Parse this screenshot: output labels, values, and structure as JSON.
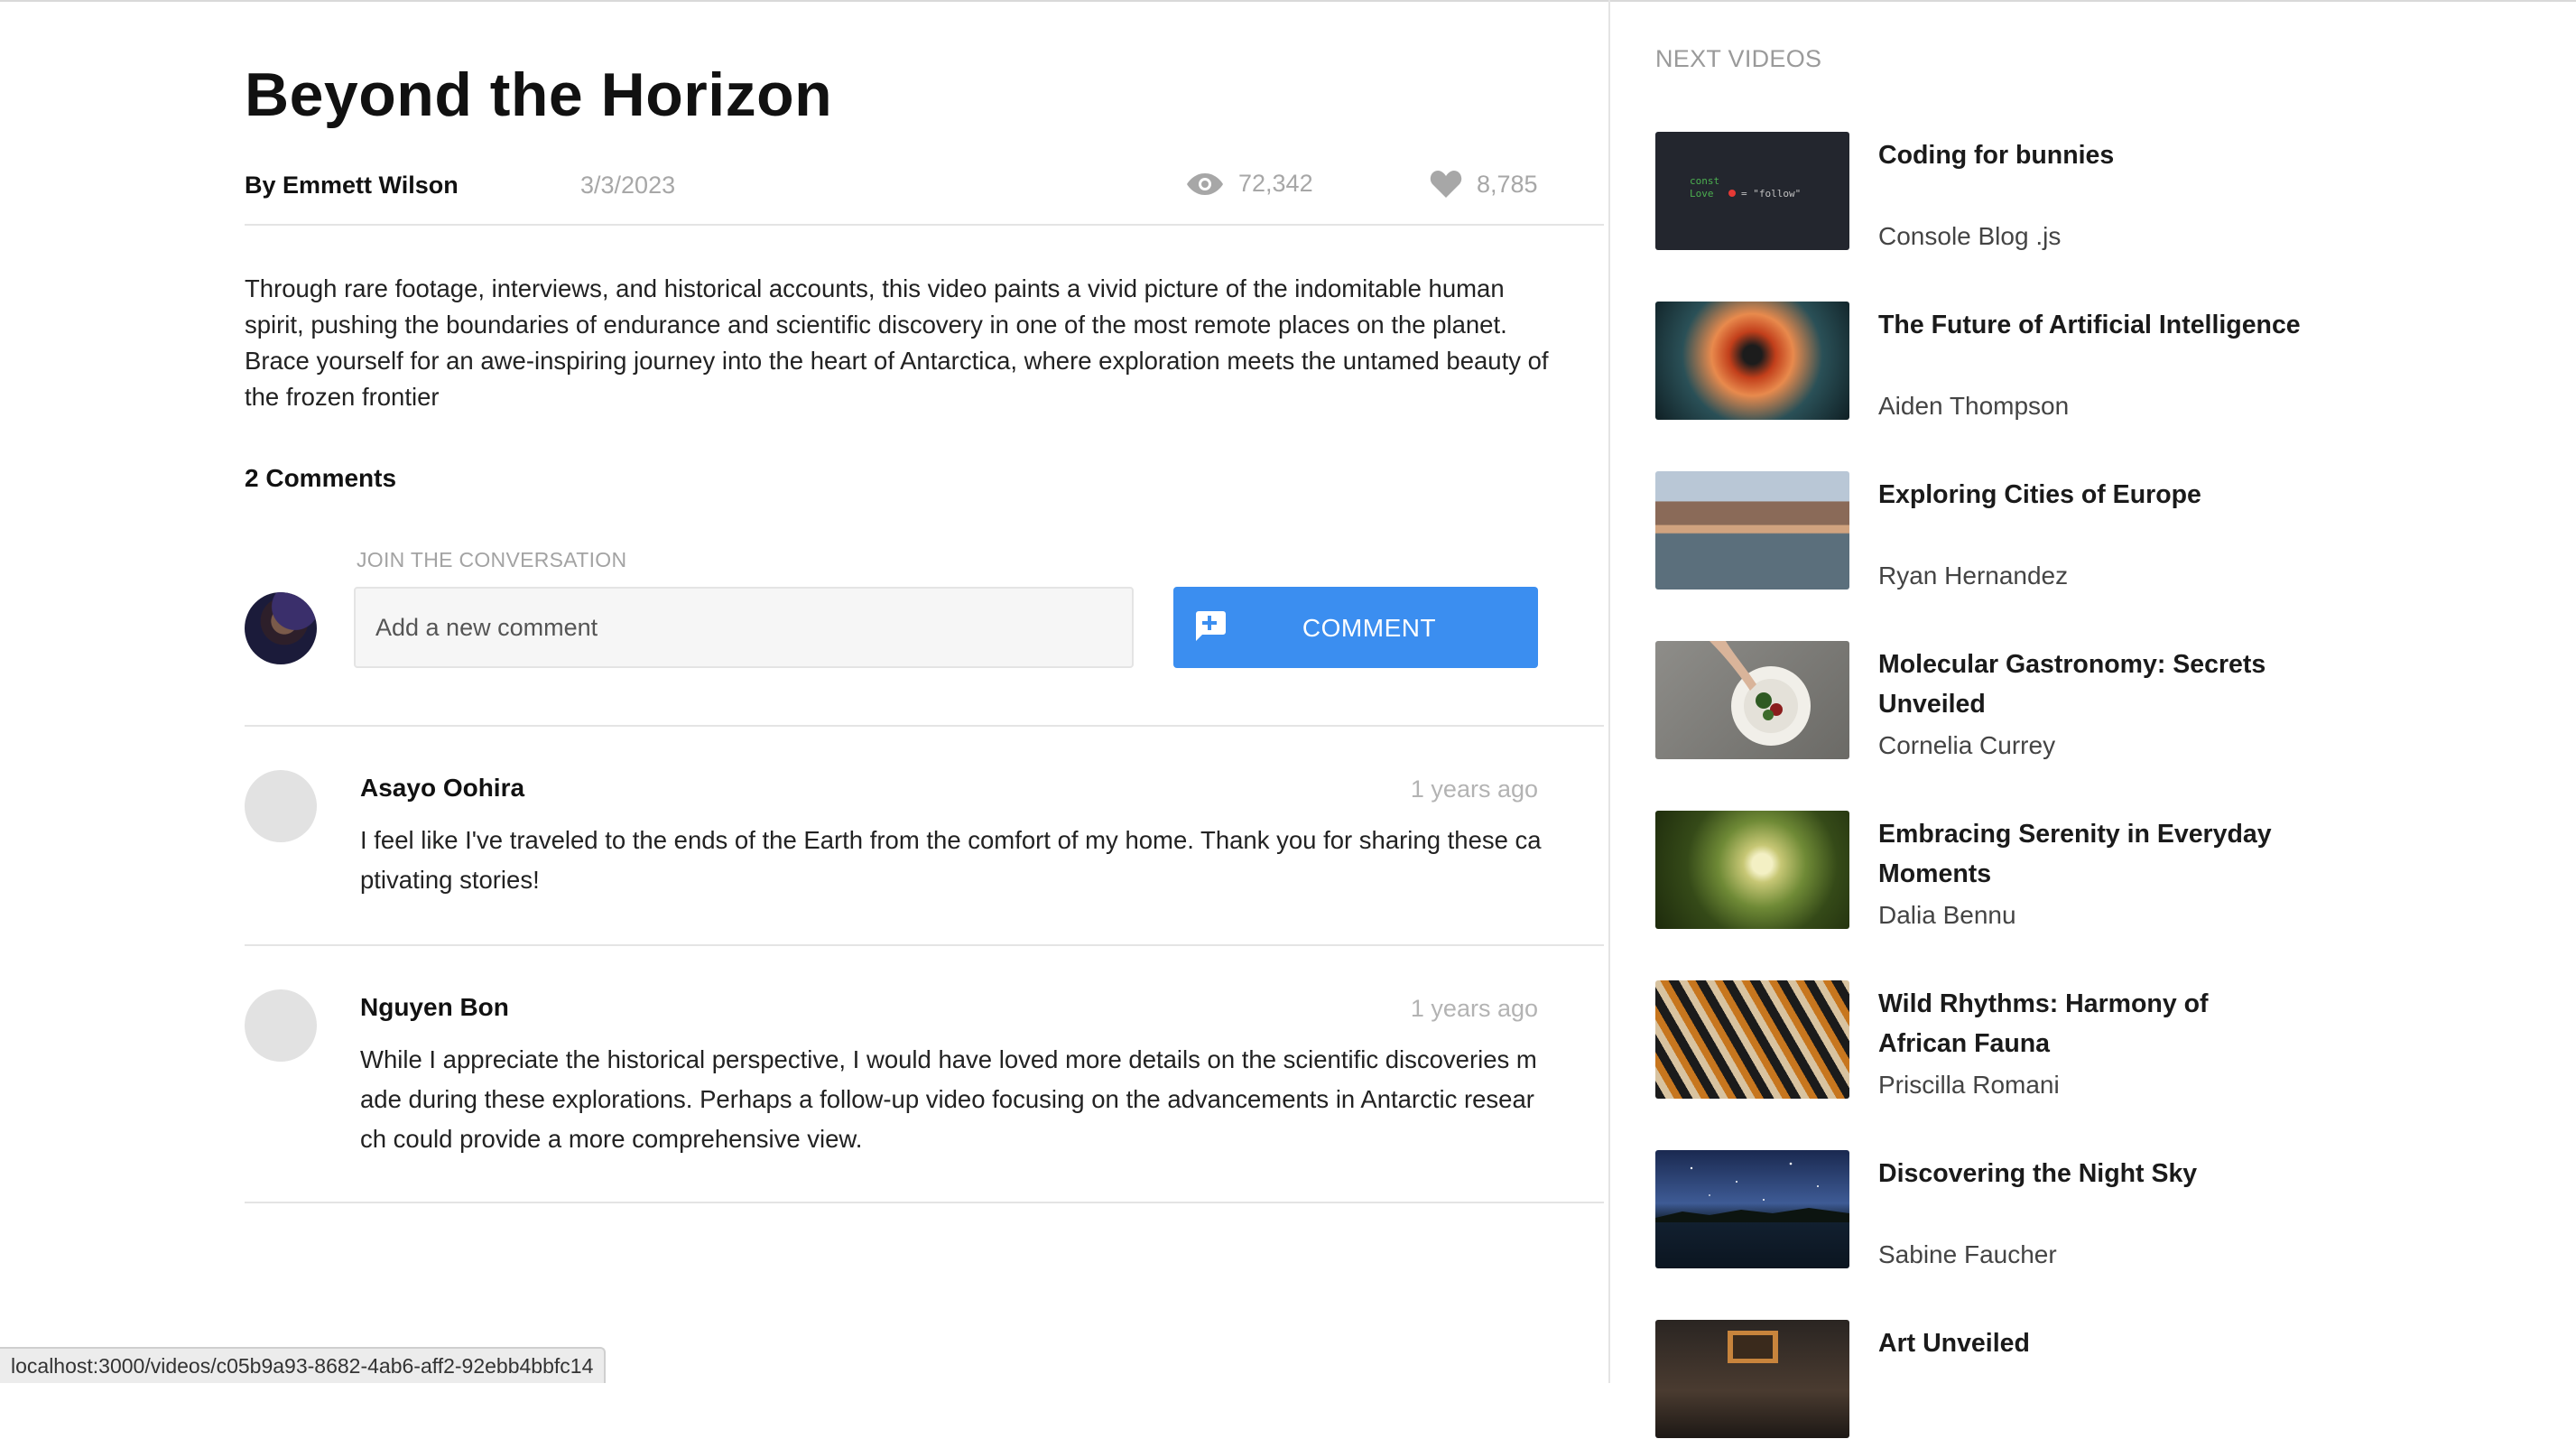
{
  "video": {
    "title": "Beyond the Horizon",
    "author": "By Emmett Wilson",
    "date": "3/3/2023",
    "views": "72,342",
    "likes": "8,785",
    "description": "Through rare footage, interviews, and historical accounts, this video paints a vivid picture of the indomitable human spirit, pushing the boundaries of endurance and scientific discovery in one of the most remote places on the planet. Brace yourself for an awe-inspiring journey into the heart of Antarctica, where exploration meets the untamed beauty of the frozen frontier"
  },
  "comments_section": {
    "count_label": "2 Comments",
    "join_label": "JOIN THE CONVERSATION",
    "input_placeholder": "Add a new comment",
    "button_label": "COMMENT",
    "comments": [
      {
        "author": "Asayo Oohira",
        "time": "1 years ago",
        "text": "I feel like I've traveled to the ends of the Earth from the comfort of my home. Thank you for sharing these captivating stories!"
      },
      {
        "author": "Nguyen Bon",
        "time": "1 years ago",
        "text": "While I appreciate the historical perspective, I would have loved more details on the scientific discoveries made during these explorations. Perhaps a follow-up video focusing on the advancements in Antarctic research could provide a more comprehensive view."
      }
    ]
  },
  "sidebar": {
    "heading": "NEXT VIDEOS",
    "videos": [
      {
        "title": "Coding for bunnies",
        "author": "Console Blog .js"
      },
      {
        "title": "The Future of Artificial Intelligence",
        "author": "Aiden Thompson"
      },
      {
        "title": "Exploring Cities of Europe",
        "author": "Ryan Hernandez"
      },
      {
        "title": "Molecular Gastronomy: Secrets Unveiled",
        "author": "Cornelia Currey"
      },
      {
        "title": "Embracing Serenity in Everyday Moments",
        "author": "Dalia Bennu"
      },
      {
        "title": "Wild Rhythms: Harmony of African Fauna",
        "author": "Priscilla Romani"
      },
      {
        "title": "Discovering the Night Sky",
        "author": "Sabine Faucher"
      },
      {
        "title": "Art Unveiled",
        "author": ""
      }
    ]
  },
  "status_bar": {
    "url": "localhost:3000/videos/c05b9a93-8682-4ab6-aff2-92ebb4bbfc14"
  },
  "colors": {
    "accent": "#3b8ef0",
    "muted_text": "#a7a7a7",
    "divider": "#e4e4e4"
  }
}
